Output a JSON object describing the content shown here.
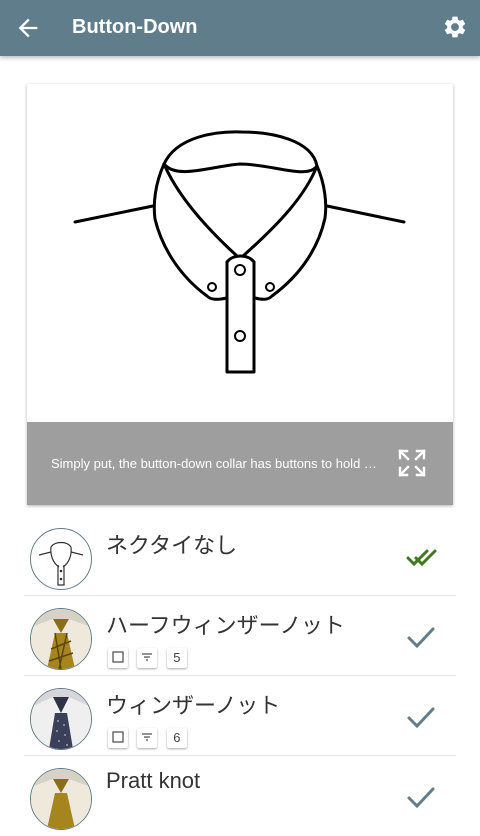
{
  "appbar": {
    "title": "Button-Down",
    "back_icon": "arrow-back-icon",
    "settings_icon": "gear-icon"
  },
  "card": {
    "illustration": "button-down-collar-icon",
    "caption": "Simply put, the button-down collar has buttons to hold down its collar points",
    "expand_icon": "fullscreen-expand-icon"
  },
  "list": {
    "items": [
      {
        "name": "ネクタイなし",
        "check": "double-check-icon",
        "check_color": "#3f7a1f",
        "tags": null
      },
      {
        "name": "ハーフウィンザーノット",
        "check": "check-icon",
        "check_color": "#607d8b",
        "tags": {
          "checkbox": "checkbox-icon",
          "filter": "filter-icon",
          "count": "5"
        }
      },
      {
        "name": "ウィンザーノット",
        "check": "check-icon",
        "check_color": "#607d8b",
        "tags": {
          "checkbox": "checkbox-icon",
          "filter": "filter-icon",
          "count": "6"
        }
      },
      {
        "name": "Pratt knot",
        "check": "check-icon",
        "check_color": "#607d8b",
        "tags": null
      }
    ]
  },
  "colors": {
    "appbar": "#607d8b",
    "caption_bar": "#9e9e9e",
    "check_primary": "#607d8b",
    "check_done": "#3f7a1f"
  }
}
